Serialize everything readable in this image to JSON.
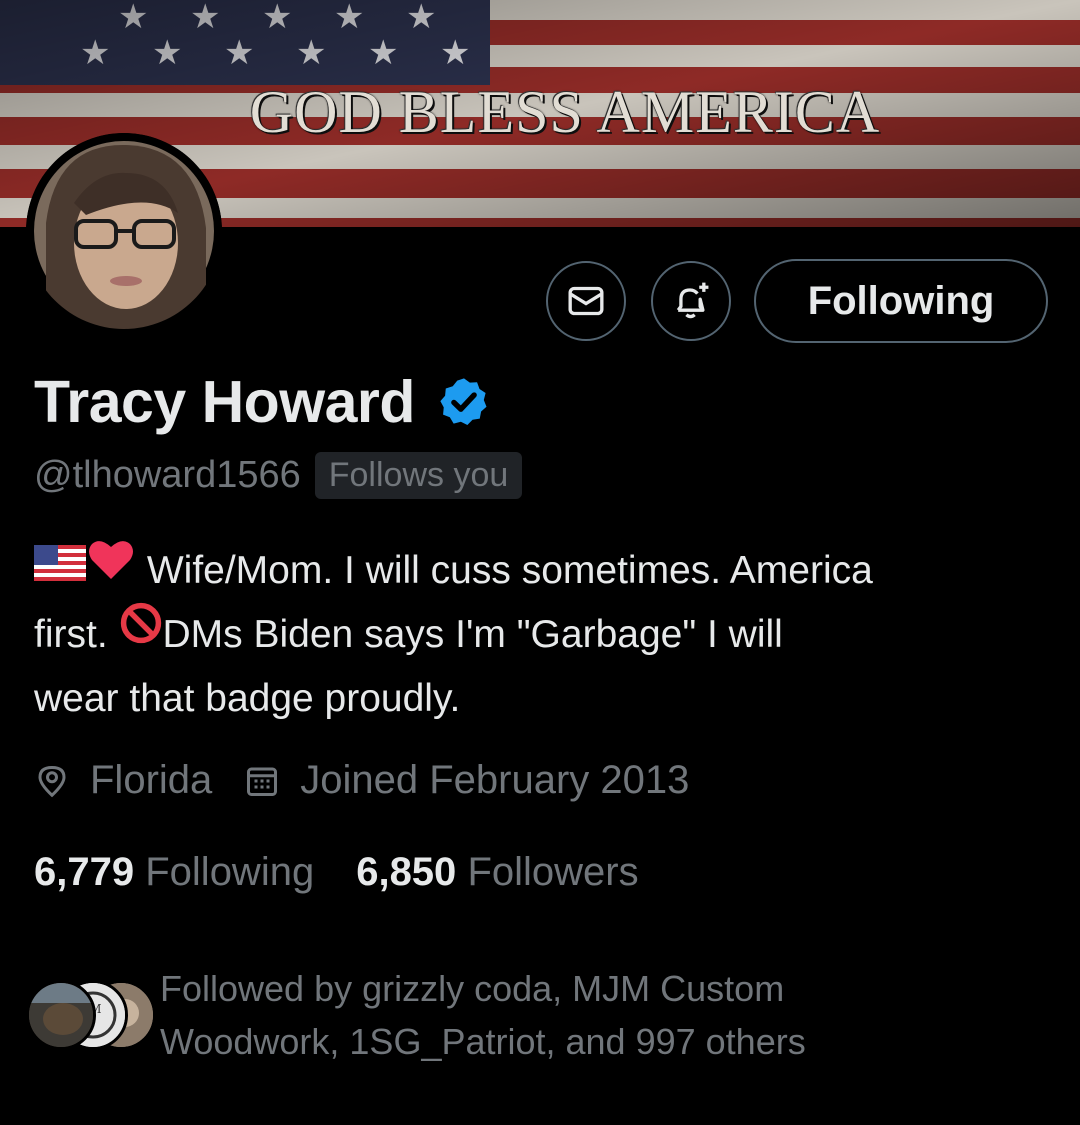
{
  "banner": {
    "text": "GOD BLESS AMERICA",
    "colors": {
      "stripe_red": "#8e2a26",
      "stripe_white": "#c9c4bb",
      "canton": "#2a2f4a"
    }
  },
  "profile": {
    "display_name": "Tracy Howard",
    "handle": "@tlhoward1566",
    "follows_you_badge": "Follows you",
    "verified": true,
    "bio_flag_emoji": "us-flag-emoji",
    "bio_line1": "Wife/Mom. I will cuss sometimes. America",
    "bio_line2_start": "first.",
    "bio_line2_end": "DMs  Biden says I'm \"Garbage\" I will",
    "bio_line3": "wear that badge proudly.",
    "location": "Florida",
    "joined": "Joined February 2013"
  },
  "actions": {
    "message_icon": "envelope-icon",
    "notify_icon": "bell-plus-icon",
    "follow_button_label": "Following"
  },
  "stats": {
    "following_count": "6,779",
    "following_label": "Following",
    "followers_count": "6,850",
    "followers_label": "Followers"
  },
  "followed_by": {
    "line1": "Followed by grizzly coda, MJM Custom",
    "line2": "Woodwork, 1SG_Patriot, and 997 others"
  },
  "colors": {
    "background": "#000000",
    "text_primary": "#e7e9ea",
    "text_secondary": "#71767b",
    "border": "#536471",
    "verified_blue": "#1d9bf0",
    "badge_bg": "#202327"
  }
}
